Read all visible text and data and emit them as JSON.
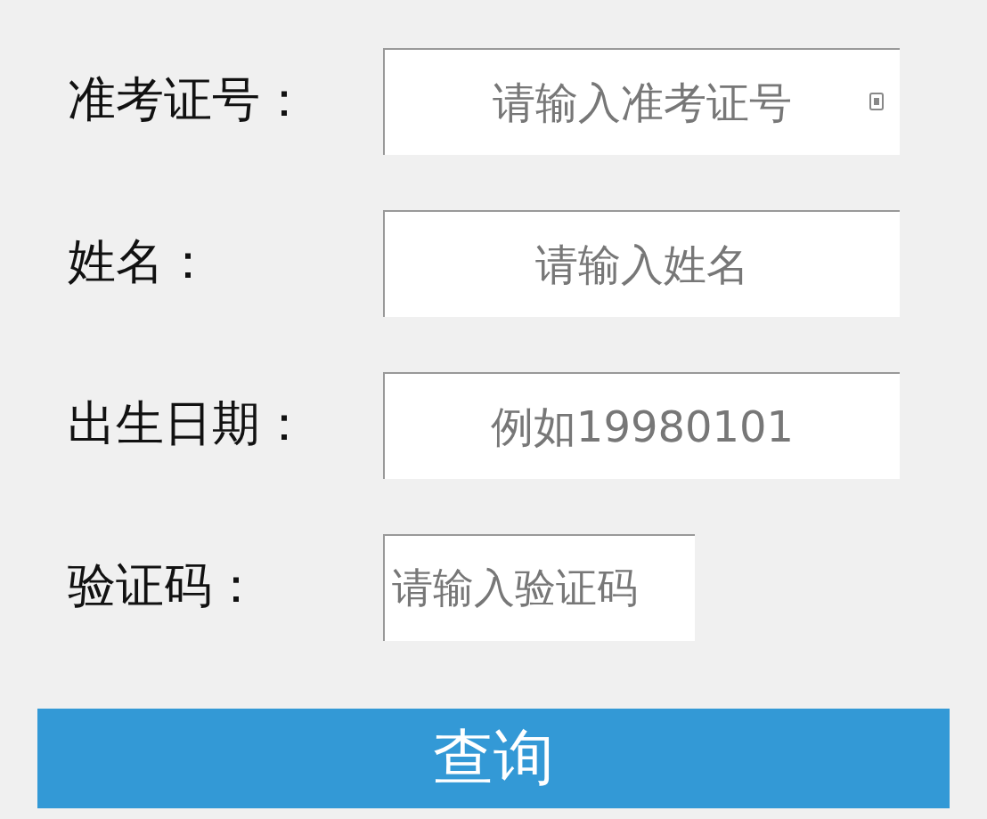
{
  "fields": [
    {
      "label": "准考证号：",
      "placeholder": "请输入准考证号",
      "kind": "wide",
      "autofill_icon": true
    },
    {
      "label": "姓名：",
      "placeholder": "请输入姓名",
      "kind": "wide",
      "autofill_icon": false
    },
    {
      "label": "出生日期：",
      "placeholder": "例如19980101",
      "kind": "wide",
      "autofill_icon": false
    },
    {
      "label": "验证码：",
      "placeholder": "请输入验证码",
      "kind": "captcha",
      "autofill_icon": false
    }
  ],
  "submit_button": "查询"
}
